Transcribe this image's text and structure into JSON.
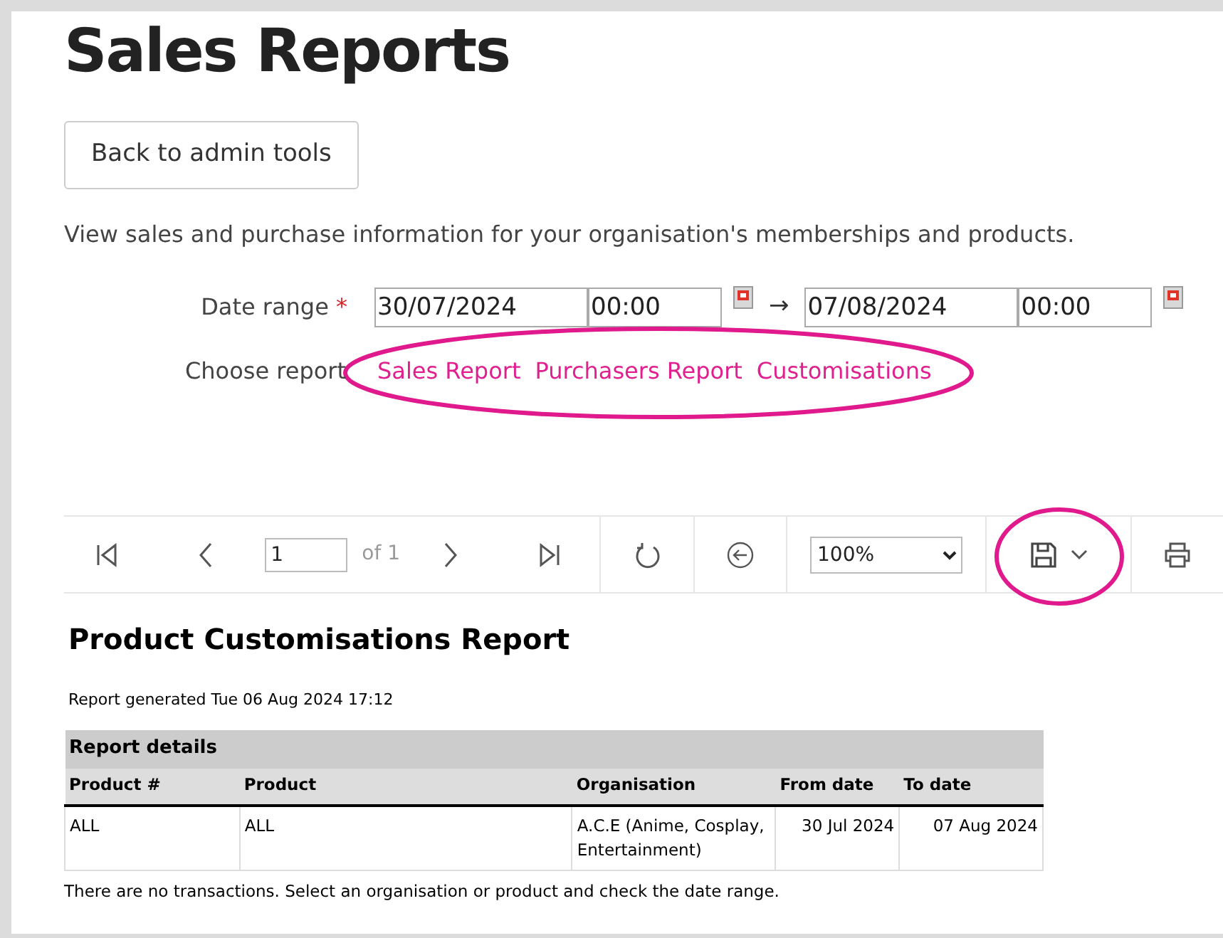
{
  "page": {
    "title": "Sales Reports",
    "back_button": "Back to admin tools",
    "description": "View sales and purchase information for your organisation's memberships and products."
  },
  "date_range": {
    "label": "Date range",
    "required_mark": "*",
    "from_date": "30/07/2024",
    "from_time": "00:00",
    "arrow": "→",
    "to_date": "07/08/2024",
    "to_time": "00:00"
  },
  "choose_report": {
    "label": "Choose report",
    "highlighted": true,
    "links": [
      "Sales Report",
      "Purchasers Report",
      "Customisations"
    ]
  },
  "toolbar": {
    "page": "1",
    "page_count": "of 1",
    "zoom": "100%",
    "save_highlighted": true
  },
  "report": {
    "title": "Product Customisations Report",
    "generated": "Report generated Tue 06 Aug 2024 17:12",
    "table": {
      "caption": "Report details",
      "columns": [
        "Product #",
        "Product",
        "Organisation",
        "From date",
        "To date"
      ],
      "rows": [
        [
          "ALL",
          "ALL",
          "A.C.E (Anime, Cosplay, Entertainment)",
          "30 Jul 2024",
          "07 Aug 2024"
        ]
      ]
    },
    "message": "There are no transactions.  Select an organisation or product and check the date range."
  }
}
